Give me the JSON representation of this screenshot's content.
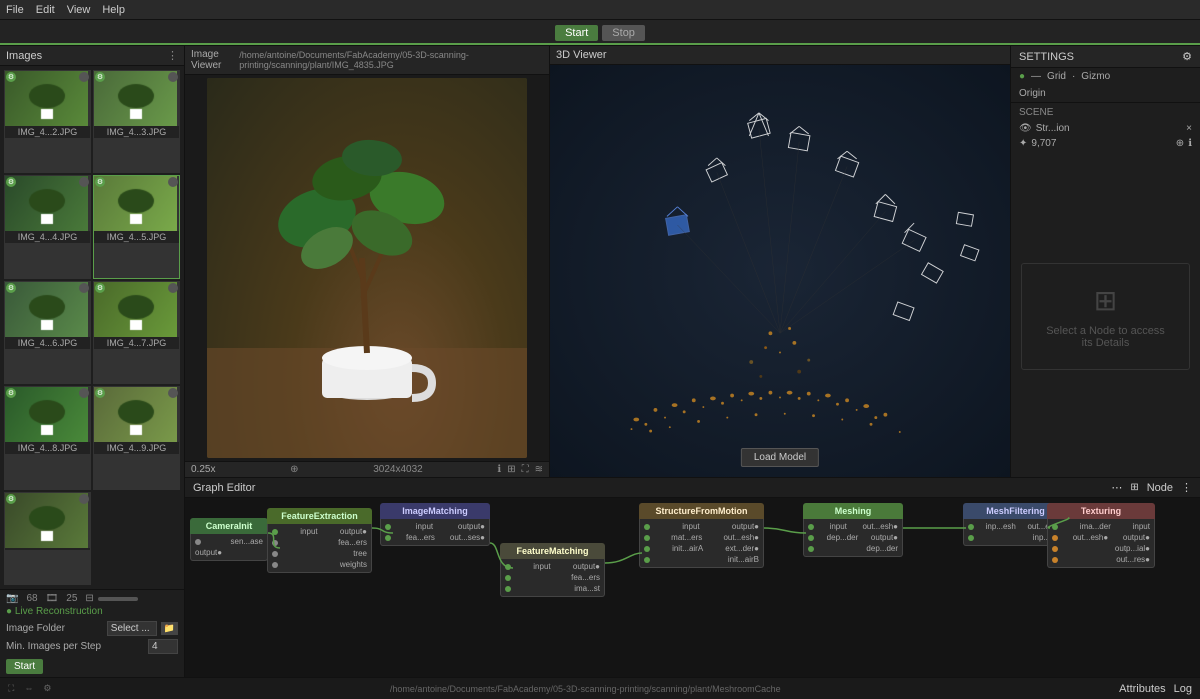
{
  "menubar": {
    "items": [
      "File",
      "Edit",
      "View",
      "Help"
    ]
  },
  "toolbar": {
    "start_label": "Start",
    "stop_label": "Stop"
  },
  "images_panel": {
    "title": "Images",
    "thumbnails": [
      {
        "label": "IMG_4...2.JPG",
        "selected": false
      },
      {
        "label": "IMG_4...3.JPG",
        "selected": false
      },
      {
        "label": "IMG_4...4.JPG",
        "selected": false
      },
      {
        "label": "IMG_4...5.JPG",
        "selected": true
      },
      {
        "label": "IMG_4...6.JPG",
        "selected": false
      },
      {
        "label": "IMG_4...7.JPG",
        "selected": false
      },
      {
        "label": "IMG_4...8.JPG",
        "selected": false
      },
      {
        "label": "IMG_4...9.JPG",
        "selected": false
      },
      {
        "label": "",
        "selected": false
      }
    ],
    "stats": {
      "cameras": "68",
      "images": "25"
    },
    "live_reconstruction": "● Live Reconstruction",
    "image_folder_label": "Image Folder",
    "image_folder_value": "Select ...",
    "min_images_label": "Min. Images per Step",
    "min_images_value": "4",
    "start_label": "Start"
  },
  "image_viewer": {
    "title": "Image Viewer",
    "path": "/home/antoine/Documents/FabAcademy/05-3D-scanning-printing/scanning/plant/IMG_4835.JPG",
    "zoom": "0.25x",
    "resolution": "3024x4032"
  },
  "viewer_3d": {
    "title": "3D Viewer",
    "load_model_label": "Load Model"
  },
  "settings": {
    "title": "SETTINGS",
    "grid_label": "Grid",
    "gizmo_label": "Gizmo",
    "origin_label": "Origin",
    "scene_label": "SCENE",
    "structure_item": "Str...ion",
    "point_count": "9,707"
  },
  "graph_editor": {
    "title": "Graph Editor",
    "node_label": "Node",
    "nodes": [
      {
        "id": "camera_init",
        "label": "CameraInit",
        "color": "#4a6a3a",
        "ports_in": [],
        "ports_out": [
          "sen...ase"
        ]
      },
      {
        "id": "feature_extraction",
        "label": "FeatureExtraction",
        "color": "#4a6a2a",
        "ports_in": [
          "input",
          "output●"
        ],
        "ports_out": [
          "fea...ers",
          "tree",
          "weights"
        ]
      },
      {
        "id": "image_matching",
        "label": "ImageMatching",
        "color": "#3a3a6a",
        "ports_in": [
          "input",
          "output●"
        ],
        "ports_out": [
          "fea...ers",
          "out...ses●"
        ]
      },
      {
        "id": "structure_from_motion",
        "label": "StructureFromMotion",
        "color": "#5a4a2a",
        "ports_in": [
          "input",
          "output●",
          "mat...ers",
          "init...airA",
          "init...airB"
        ],
        "ports_out": [
          "out...esh●",
          "ext...der●"
        ]
      },
      {
        "id": "feature_matching",
        "label": "FeatureMatching",
        "color": "#4a4a3a",
        "ports_in": [
          "input",
          "output●"
        ],
        "ports_out": [
          "fea...ers",
          "ima...st"
        ]
      },
      {
        "id": "meshing",
        "label": "Meshing",
        "color": "#4a7a3a",
        "ports_in": [
          "input",
          "dep...der",
          "dep...der"
        ],
        "ports_out": [
          "out...esh●",
          "output●"
        ]
      },
      {
        "id": "mesh_filtering",
        "label": "MeshFiltering",
        "color": "#3a4a6a",
        "ports_in": [
          "inp...esh",
          "inp...esh"
        ],
        "ports_out": [
          "out...esh●"
        ]
      },
      {
        "id": "texturing",
        "label": "Texturing",
        "color": "#6a3a3a",
        "ports_in": [
          "ima...der",
          "out...esh●",
          "outp...ial●",
          "out...res●"
        ],
        "ports_out": [
          "input",
          "output●"
        ]
      }
    ]
  },
  "bottom_bar": {
    "path": "/home/antoine/Documents/FabAcademy/05-3D-scanning-printing/scanning/plant/MeshroomCache",
    "tabs": [
      "Attributes",
      "Log"
    ]
  },
  "node_panel": {
    "placeholder": "Select a Node to access its Details"
  }
}
